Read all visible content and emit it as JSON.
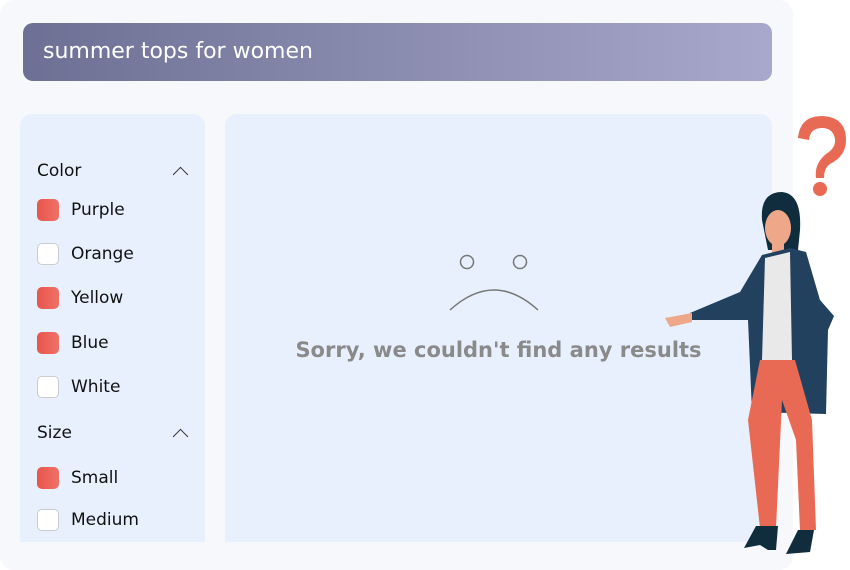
{
  "search": {
    "query": "summer tops for women"
  },
  "filters": {
    "color": {
      "title": "Color",
      "options": [
        {
          "label": "Purple",
          "checked": true
        },
        {
          "label": "Orange",
          "checked": false
        },
        {
          "label": "Yellow",
          "checked": true
        },
        {
          "label": "Blue",
          "checked": true
        },
        {
          "label": "White",
          "checked": false
        }
      ]
    },
    "size": {
      "title": "Size",
      "options": [
        {
          "label": "Small",
          "checked": true
        },
        {
          "label": "Medium",
          "checked": false
        }
      ]
    }
  },
  "results": {
    "empty_message": "Sorry, we couldn't find any results",
    "icon": "sad-face-icon"
  },
  "colors": {
    "accent": "#e9544a",
    "panel": "#e8f0fe"
  }
}
